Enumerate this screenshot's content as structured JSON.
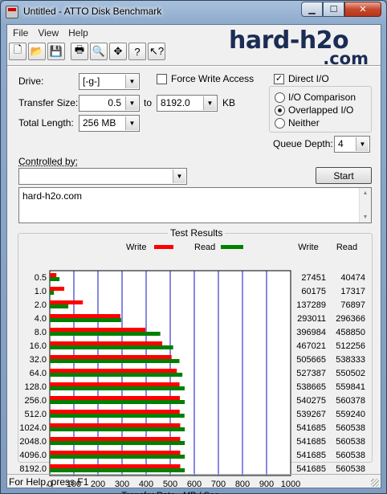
{
  "window": {
    "title": "Untitled - ATTO Disk Benchmark"
  },
  "caption_buttons": {
    "minimize": "▁",
    "maximize": "☐",
    "close": "✕"
  },
  "menu": [
    "File",
    "View",
    "Help"
  ],
  "brand": {
    "line1": "hard-h2o",
    "line2": ".com"
  },
  "toolbar_icons": [
    "new-icon",
    "open-icon",
    "save-icon",
    "print-icon",
    "print-preview-icon",
    "move-icon",
    "help-icon",
    "context-help-icon"
  ],
  "toolbar_glyphs": [
    "🗋",
    "📂",
    "💾",
    "🖶",
    "🔍",
    "✥",
    "?",
    "↖?"
  ],
  "form": {
    "drive_label": "Drive:",
    "drive_value": "[-g-]",
    "force_write_label": "Force Write Access",
    "force_write_checked": false,
    "direct_io_label": "Direct I/O",
    "direct_io_checked": true,
    "transfer_size_label": "Transfer Size:",
    "transfer_from": "0.5",
    "transfer_to_label": "to",
    "transfer_to": "8192.0",
    "transfer_unit": "KB",
    "total_length_label": "Total Length:",
    "total_length_value": "256 MB",
    "io_options": [
      {
        "label": "I/O Comparison",
        "selected": false
      },
      {
        "label": "Overlapped I/O",
        "selected": true
      },
      {
        "label": "Neither",
        "selected": false
      }
    ],
    "queue_depth_label": "Queue Depth:",
    "queue_depth_value": "4",
    "controlled_by_label": "Controlled by:",
    "controlled_by_value": "",
    "start_label": "Start",
    "description_text": "hard-h2o.com"
  },
  "results": {
    "title": "Test Results",
    "write_legend": "Write",
    "read_legend": "Read",
    "write_col": "Write",
    "read_col": "Read"
  },
  "chart_data": {
    "type": "bar",
    "orientation": "horizontal",
    "xlabel": "Transfer Rate - MB / Sec",
    "xlim": [
      0,
      1000
    ],
    "xticks": [
      "0",
      "100",
      "200",
      "300",
      "400",
      "500",
      "600",
      "700",
      "800",
      "900",
      "1000"
    ],
    "categories": [
      "0.5",
      "1.0",
      "2.0",
      "4.0",
      "8.0",
      "16.0",
      "32.0",
      "64.0",
      "128.0",
      "256.0",
      "512.0",
      "1024.0",
      "2048.0",
      "4096.0",
      "8192.0"
    ],
    "series": [
      {
        "name": "Write",
        "color": "#ff0000",
        "values": [
          27451,
          60175,
          137289,
          293011,
          396984,
          467021,
          505665,
          527387,
          538665,
          540275,
          539267,
          541685,
          541685,
          541685,
          541685
        ]
      },
      {
        "name": "Read",
        "color": "#008000",
        "values": [
          40474,
          17317,
          76897,
          296366,
          458850,
          512256,
          538333,
          550502,
          559841,
          560378,
          559240,
          560538,
          560538,
          560538,
          560538
        ]
      }
    ],
    "grid": true,
    "legend": "top"
  },
  "status": {
    "text": "For Help, press F1"
  }
}
